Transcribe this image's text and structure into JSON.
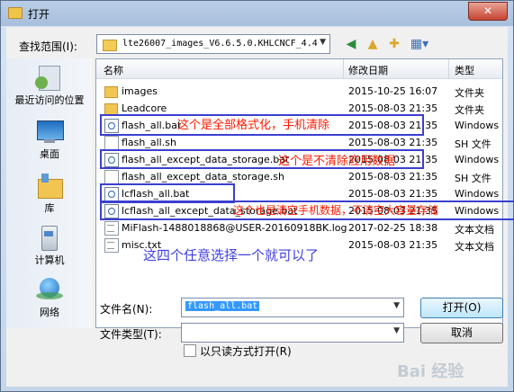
{
  "window": {
    "title": "打开",
    "close": "✕"
  },
  "toolbar": {
    "look_in_label": "查找范围(I):",
    "look_in_value": "lte26007_images_V6.6.5.0.KHLCNCF_4.4",
    "back_icon": "back-arrow-icon",
    "up_icon": "up-folder-icon",
    "new_folder_icon": "new-folder-icon",
    "view_icon": "view-menu-icon"
  },
  "places": [
    {
      "label": "最近访问的位置",
      "icon": "recent-places-icon"
    },
    {
      "label": "桌面",
      "icon": "desktop-icon"
    },
    {
      "label": "库",
      "icon": "libraries-icon"
    },
    {
      "label": "计算机",
      "icon": "computer-icon"
    },
    {
      "label": "网络",
      "icon": "network-icon"
    }
  ],
  "columns": {
    "name": "名称",
    "date": "修改日期",
    "type": "类型"
  },
  "files": [
    {
      "name": "images",
      "date": "2015-10-25 16:07",
      "type": "文件夹",
      "icon": "folder"
    },
    {
      "name": "Leadcore",
      "date": "2015-08-03 21:35",
      "type": "文件夹",
      "icon": "folder"
    },
    {
      "name": "flash_all.bat",
      "date": "2015-08-03 21:35",
      "type": "Windows",
      "icon": "bat"
    },
    {
      "name": "flash_all.sh",
      "date": "2015-08-03 21:35",
      "type": "SH 文件",
      "icon": "doc"
    },
    {
      "name": "flash_all_except_data_storage.bat",
      "date": "2015-08-03 21:35",
      "type": "Windows",
      "icon": "bat"
    },
    {
      "name": "flash_all_except_data_storage.sh",
      "date": "2015-08-03 21:35",
      "type": "SH 文件",
      "icon": "doc"
    },
    {
      "name": "lcflash_all.bat",
      "date": "2015-08-03 21:35",
      "type": "Windows",
      "icon": "bat"
    },
    {
      "name": "lcflash_all_except_data_storage.bat",
      "date": "2015-08-03 21:35",
      "type": "Windows",
      "icon": "bat"
    },
    {
      "name": "MiFlash-1488018868@USER-20160918BK.log",
      "date": "2017-02-25 18:38",
      "type": "文本文档",
      "icon": "txt"
    },
    {
      "name": "misc.txt",
      "date": "2015-08-03 21:35",
      "type": "文本文档",
      "icon": "txt"
    }
  ],
  "annotations": {
    "note1": "这个是全部格式化，手机清除",
    "note2": "这个是不清除应用数据",
    "note3": "这个也是清空手机数据，不清空大容量存储",
    "note4": "这四个任意选择一个就可以了"
  },
  "bottom": {
    "filename_label": "文件名(N):",
    "filename_value": "flash_all.bat",
    "filetype_label": "文件类型(T):",
    "filetype_value": "",
    "open_button": "打开(O)",
    "cancel_button": "取消",
    "readonly_label": "以只读方式打开(R)"
  },
  "watermark": "Bai 经验"
}
